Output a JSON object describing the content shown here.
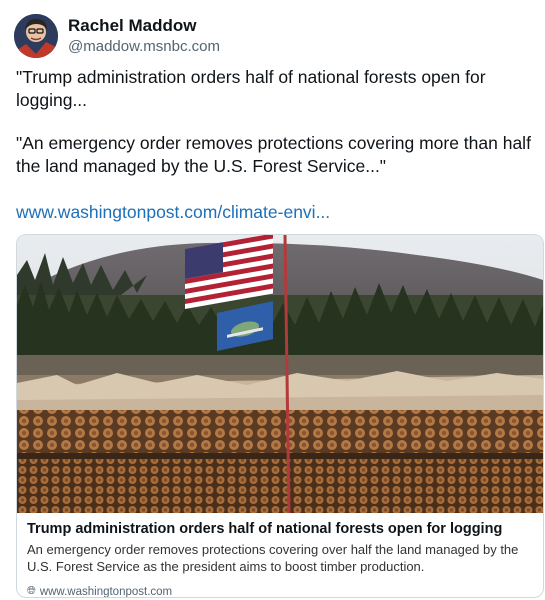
{
  "author": {
    "display_name": "Rachel Maddow",
    "handle": "@maddow.msnbc.com",
    "avatar_icon": "profile-avatar"
  },
  "post": {
    "paragraph_1": "\"Trump administration orders half of national forests open for logging...",
    "paragraph_2": "\"An emergency order removes protections covering more than half the land managed by the U.S. Forest Service...\"",
    "link_text": "www.washingtonpost.com/climate-envi..."
  },
  "link_card": {
    "image_description_icon": "forest-logging-photo",
    "title": "Trump administration orders half of national forests open for logging",
    "description": "An emergency order removes protections covering over half the land managed by the U.S. Forest Service as the president aims to boost timber production.",
    "domain": "www.washingtonpost.com",
    "domain_icon": "globe-icon"
  },
  "colors": {
    "link": "#1d6fb8",
    "text": "#0f1419",
    "muted": "#536471",
    "border": "#cfd9de"
  }
}
